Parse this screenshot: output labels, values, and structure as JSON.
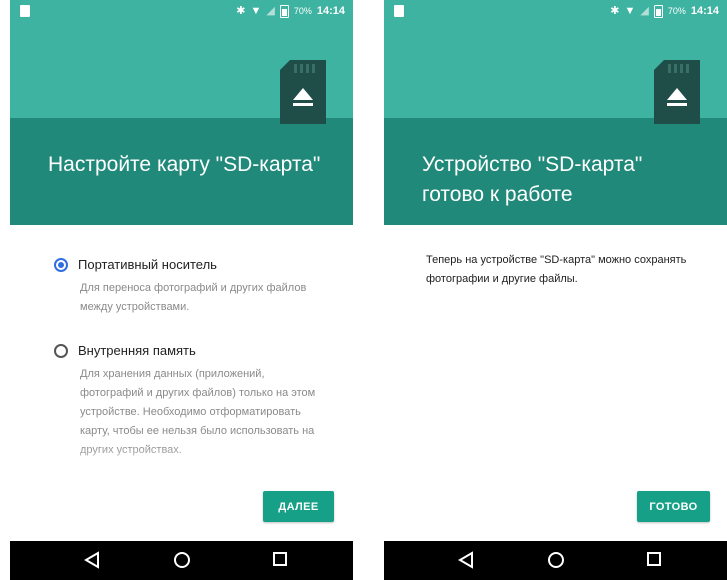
{
  "left": {
    "status": {
      "battery": "70%",
      "time": "14:14"
    },
    "title": "Настройте карту \"SD-карта\"",
    "options": [
      {
        "label": "Портативный носитель",
        "description": "Для переноса фотографий и других файлов между устройствами.",
        "selected": true
      },
      {
        "label": "Внутренняя память",
        "description": "Для хранения данных (приложений, фотографий и других файлов) только на этом устройстве. Необходимо отформатировать карту, чтобы ее нельзя было использовать на других устройствах.",
        "selected": false
      }
    ],
    "button": "ДАЛЕЕ"
  },
  "right": {
    "status": {
      "battery": "70%",
      "time": "14:14"
    },
    "title": "Устройство \"SD-карта\" готово к работе",
    "message": "Теперь на устройстве \"SD-карта\" можно сохранять фотографии и другие файлы.",
    "button": "ГОТОВО"
  },
  "colors": {
    "hero_light": "#3fb3a2",
    "hero_dark": "#21897a",
    "accent_button": "#16a088",
    "radio_selected": "#2f6fe0"
  },
  "icons": [
    "sd-card-icon",
    "eject-icon",
    "bluetooth-icon",
    "wifi-icon",
    "signal-icon",
    "battery-icon",
    "nav-back-icon",
    "nav-home-icon",
    "nav-recents-icon"
  ]
}
